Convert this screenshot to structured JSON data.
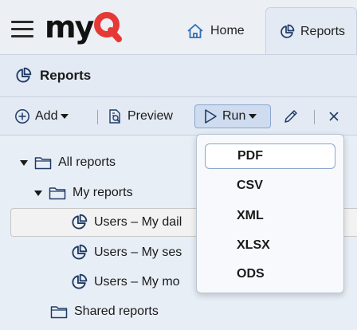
{
  "app": {
    "logo_text": "myQ",
    "accent": "#e53935"
  },
  "tabs": [
    {
      "label": "Home",
      "icon": "home-icon"
    },
    {
      "label": "Reports",
      "icon": "reports-icon",
      "active": true
    }
  ],
  "header": {
    "title": "Reports",
    "icon": "reports-icon"
  },
  "toolbar": {
    "add_label": "Add",
    "preview_label": "Preview",
    "run_label": "Run",
    "edit_icon": "pencil-icon",
    "close_icon": "close-icon"
  },
  "tree": {
    "items": [
      {
        "label": "All reports",
        "type": "folder",
        "expanded": true
      },
      {
        "label": "My reports",
        "type": "folder",
        "expanded": true
      },
      {
        "label": "Users – My dail",
        "type": "report",
        "selected": true
      },
      {
        "label": "Users – My ses",
        "type": "report"
      },
      {
        "label": "Users – My mo",
        "type": "report"
      },
      {
        "label": "Shared reports",
        "type": "folder"
      }
    ]
  },
  "run_menu": {
    "options": [
      "PDF",
      "CSV",
      "XML",
      "XLSX",
      "ODS"
    ],
    "highlighted": "PDF"
  }
}
